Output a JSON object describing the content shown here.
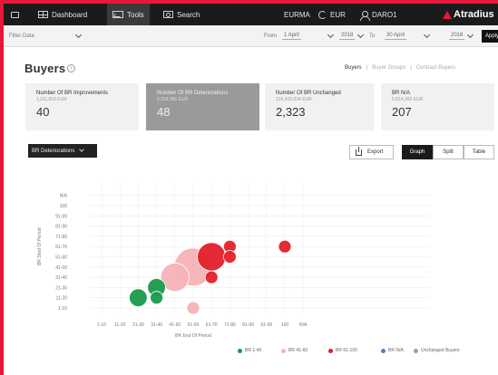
{
  "nav": {
    "items": [
      {
        "label": "Dashboard",
        "icon": "grid-icon"
      },
      {
        "label": "Tools",
        "icon": "tools-icon",
        "active": true
      },
      {
        "label": "Search",
        "icon": "search-icon"
      }
    ],
    "region": "EURMA",
    "currency": "EUR",
    "user": "DARO1",
    "brand": "Atradius"
  },
  "filter": {
    "label": "Filter Data",
    "from_label": "From",
    "from_day": "1 April",
    "from_year": "2018",
    "to_label": "To",
    "to_day": "30 April",
    "to_year": "2018",
    "apply_label": "Apply"
  },
  "header": {
    "title": "Buyers",
    "tabs": [
      "Buyers",
      "Buyer Groups",
      "Contract Buyers"
    ],
    "active_tab": "Buyers"
  },
  "kpis": [
    {
      "label": "Number Of BR Improvements",
      "sub": "1,311,603 EUR",
      "value": "40"
    },
    {
      "label": "Number Of BR Deteriorations",
      "sub": "2,254,086 EUR",
      "value": "48",
      "selected": true
    },
    {
      "label": "Number Of BR Unchanged",
      "sub": "126,410,034 EUR",
      "value": "2,323"
    },
    {
      "label": "BR N/A",
      "sub": "5,814,366 EUR",
      "value": "207"
    }
  ],
  "controls": {
    "dropdown": "BR Deteriorations",
    "export": "Export",
    "views": [
      "Graph",
      "Split",
      "Table"
    ],
    "active_view": "Graph"
  },
  "chart_data": {
    "type": "scatter",
    "xlabel": "BR End Of Period",
    "ylabel": "BR Start Of Period",
    "x_categories": [
      "1-10",
      "11-20",
      "21-30",
      "31-40",
      "41-50",
      "51-60",
      "61-70",
      "71-80",
      "81-90",
      "91-99",
      "100",
      "N/A"
    ],
    "y_categories": [
      "1-10",
      "11-20",
      "21-30",
      "31-40",
      "41-50",
      "51-60",
      "61-70",
      "71-80",
      "81-90",
      "91-99",
      "100",
      "N/A"
    ],
    "points": [
      {
        "x": "21-30",
        "y": "11-20",
        "size": 2,
        "group": "BR 1-40"
      },
      {
        "x": "31-40",
        "y": "21-30",
        "size": 2,
        "group": "BR 1-40"
      },
      {
        "x": "31-40",
        "y": "11-20",
        "size": 1,
        "group": "BR 1-40"
      },
      {
        "x": "41-50",
        "y": "31-40",
        "size": 5,
        "group": "BR 41-60"
      },
      {
        "x": "51-60",
        "y": "41-50",
        "size": 9,
        "group": "BR 41-60"
      },
      {
        "x": "51-60",
        "y": "1-10",
        "size": 1,
        "group": "BR 41-60"
      },
      {
        "x": "61-70",
        "y": "51-60",
        "size": 5,
        "group": "BR 61-100"
      },
      {
        "x": "61-70",
        "y": "31-40",
        "size": 1,
        "group": "BR 61-100"
      },
      {
        "x": "71-80",
        "y": "61-70",
        "size": 1,
        "group": "BR 61-100"
      },
      {
        "x": "71-80",
        "y": "51-60",
        "size": 1,
        "group": "BR 61-100"
      },
      {
        "x": "100",
        "y": "61-70",
        "size": 1,
        "group": "BR 61-100"
      }
    ],
    "legend": [
      {
        "name": "BR 1-40",
        "color": "#1a9a4b"
      },
      {
        "name": "BR 41-60",
        "color": "#f6b3b6"
      },
      {
        "name": "BR 61-100",
        "color": "#e3202a"
      },
      {
        "name": "BR N/A",
        "color": "#3e84c9"
      },
      {
        "name": "Unchanged Buyers",
        "color": "#9e9e9e"
      }
    ],
    "legend_position": "bottom",
    "grid": true
  }
}
